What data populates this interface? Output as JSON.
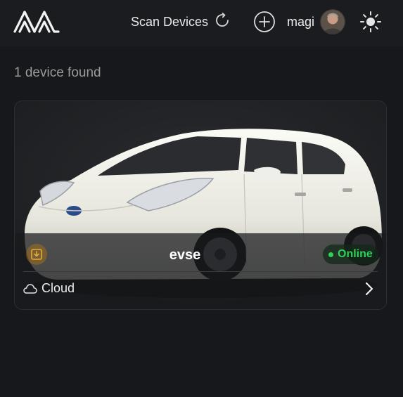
{
  "header": {
    "scan_label": "Scan Devices",
    "user_name": "magi",
    "logo_icon": "brand-logo-icon",
    "scan_icon": "refresh-icon",
    "add_icon": "add-circle-icon",
    "theme_icon": "sun-icon"
  },
  "main": {
    "device_count_text": "1 device found"
  },
  "device": {
    "name": "evse",
    "status": "Online",
    "connection": "Cloud",
    "status_color": "#2fcf59",
    "accent_color": "#b07814"
  }
}
